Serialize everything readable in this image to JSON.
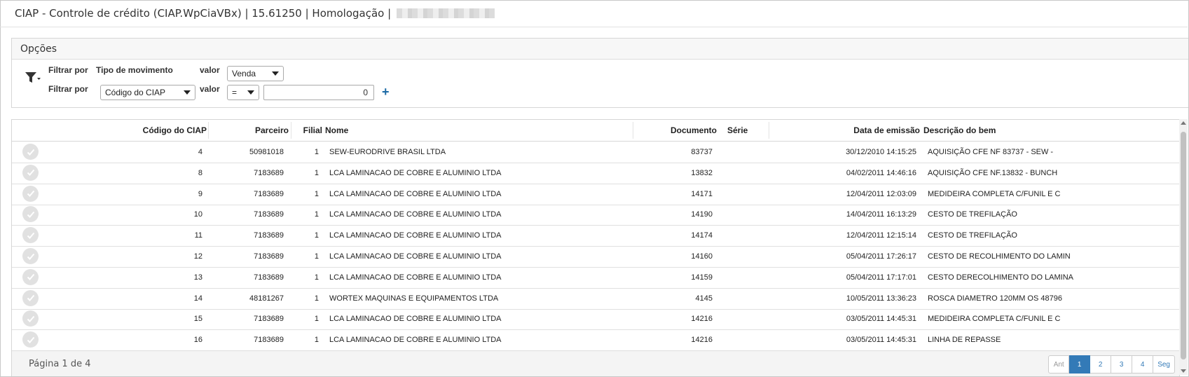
{
  "window": {
    "title": "CIAP - Controle de crédito (CIAP.WpCiaVBx) | 15.61250 | Homologação |"
  },
  "options": {
    "title": "Opções",
    "filter1": {
      "label": "Filtrar por",
      "field": "Tipo de movimento",
      "value_label": "valor",
      "value": "Venda"
    },
    "filter2": {
      "label": "Filtrar por",
      "field": "Código do CIAP",
      "value_label": "valor",
      "operator": "=",
      "value": "0"
    },
    "add_symbol": "+"
  },
  "grid": {
    "columns": {
      "codigo": "Código do CIAP",
      "parceiro": "Parceiro",
      "filial": "Filial",
      "nome": "Nome",
      "documento": "Documento",
      "serie": "Série",
      "data": "Data de emissão",
      "descricao": "Descrição do bem"
    },
    "rows": [
      {
        "codigo": "4",
        "parceiro": "50981018",
        "filial": "1",
        "nome": "SEW-EURODRIVE BRASIL LTDA",
        "documento": "83737",
        "serie": "",
        "data": "30/12/2010 14:15:25",
        "descricao": "AQUISIÇÃO CFE NF 83737 - SEW -"
      },
      {
        "codigo": "8",
        "parceiro": "7183689",
        "filial": "1",
        "nome": "LCA LAMINACAO DE COBRE E ALUMINIO LTDA",
        "documento": "13832",
        "serie": "",
        "data": "04/02/2011 14:46:16",
        "descricao": "AQUISIÇÃO CFE NF.13832 - BUNCH"
      },
      {
        "codigo": "9",
        "parceiro": "7183689",
        "filial": "1",
        "nome": "LCA LAMINACAO DE COBRE E ALUMINIO LTDA",
        "documento": "14171",
        "serie": "",
        "data": "12/04/2011 12:03:09",
        "descricao": "MEDIDEIRA COMPLETA C/FUNIL E C"
      },
      {
        "codigo": "10",
        "parceiro": "7183689",
        "filial": "1",
        "nome": "LCA LAMINACAO DE COBRE E ALUMINIO LTDA",
        "documento": "14190",
        "serie": "",
        "data": "14/04/2011 16:13:29",
        "descricao": "CESTO DE TREFILAÇÃO"
      },
      {
        "codigo": "11",
        "parceiro": "7183689",
        "filial": "1",
        "nome": "LCA LAMINACAO DE COBRE E ALUMINIO LTDA",
        "documento": "14174",
        "serie": "",
        "data": "12/04/2011 12:15:14",
        "descricao": "CESTO DE TREFILAÇÃO"
      },
      {
        "codigo": "12",
        "parceiro": "7183689",
        "filial": "1",
        "nome": "LCA LAMINACAO DE COBRE E ALUMINIO LTDA",
        "documento": "14160",
        "serie": "",
        "data": "05/04/2011 17:26:17",
        "descricao": "CESTO DE RECOLHIMENTO DO LAMIN"
      },
      {
        "codigo": "13",
        "parceiro": "7183689",
        "filial": "1",
        "nome": "LCA LAMINACAO DE COBRE E ALUMINIO LTDA",
        "documento": "14159",
        "serie": "",
        "data": "05/04/2011 17:17:01",
        "descricao": "CESTO DERECOLHIMENTO DO LAMINA"
      },
      {
        "codigo": "14",
        "parceiro": "48181267",
        "filial": "1",
        "nome": "WORTEX MAQUINAS E EQUIPAMENTOS LTDA",
        "documento": "4145",
        "serie": "",
        "data": "10/05/2011 13:36:23",
        "descricao": "ROSCA DIAMETRO 120MM OS 48796"
      },
      {
        "codigo": "15",
        "parceiro": "7183689",
        "filial": "1",
        "nome": "LCA LAMINACAO DE COBRE E ALUMINIO LTDA",
        "documento": "14216",
        "serie": "",
        "data": "03/05/2011 14:45:31",
        "descricao": "MEDIDEIRA COMPLETA C/FUNIL E C"
      },
      {
        "codigo": "16",
        "parceiro": "7183689",
        "filial": "1",
        "nome": "LCA LAMINACAO DE COBRE E ALUMINIO LTDA",
        "documento": "14216",
        "serie": "",
        "data": "03/05/2011 14:45:31",
        "descricao": "LINHA DE REPASSE"
      }
    ]
  },
  "footer": {
    "page_info": "Página 1 de 4",
    "pager": {
      "prev": "Ant",
      "pages": [
        "1",
        "2",
        "3",
        "4"
      ],
      "next": "Seg",
      "active": "1"
    }
  },
  "colors": {
    "accent": "#337ab7",
    "plus": "#1b6aa5",
    "check_bg": "#e1e1e1"
  },
  "icons": {
    "filter": "filter-icon",
    "row_check": "check-circle-icon"
  }
}
